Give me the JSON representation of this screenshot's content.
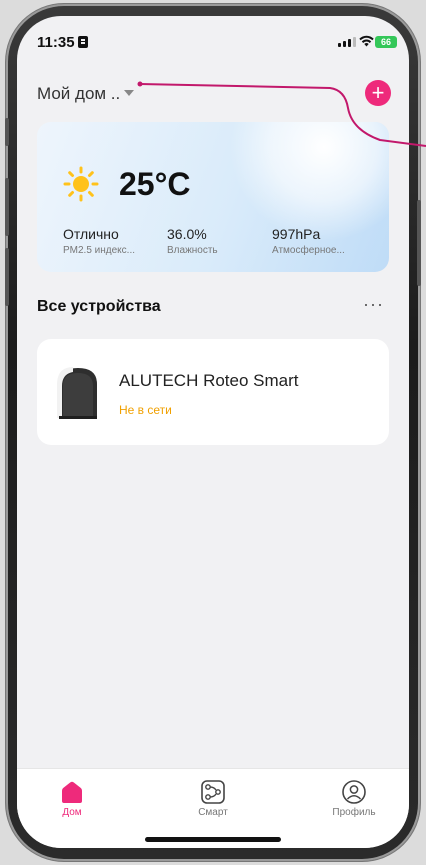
{
  "status_bar": {
    "time": "11:35",
    "battery": "66"
  },
  "header": {
    "home_name": "Мой дом .."
  },
  "weather": {
    "temperature": "25°C",
    "stats": [
      {
        "value": "Отлично",
        "label": "PM2.5 индекс..."
      },
      {
        "value": "36.0%",
        "label": "Влажность"
      },
      {
        "value": "997hPa",
        "label": "Атмосферное..."
      }
    ]
  },
  "devices_section": {
    "title": "Все устройства",
    "more": "···"
  },
  "device": {
    "name": "ALUTECH Roteo Smart",
    "status": "Не в сети"
  },
  "tabs": [
    {
      "label": "Дом",
      "icon": "home-icon",
      "active": true
    },
    {
      "label": "Смарт",
      "icon": "smart-icon",
      "active": false
    },
    {
      "label": "Профиль",
      "icon": "profile-icon",
      "active": false
    }
  ],
  "colors": {
    "accent": "#ee2a7b",
    "offline": "#f0a000",
    "annotation": "#c2186b"
  }
}
